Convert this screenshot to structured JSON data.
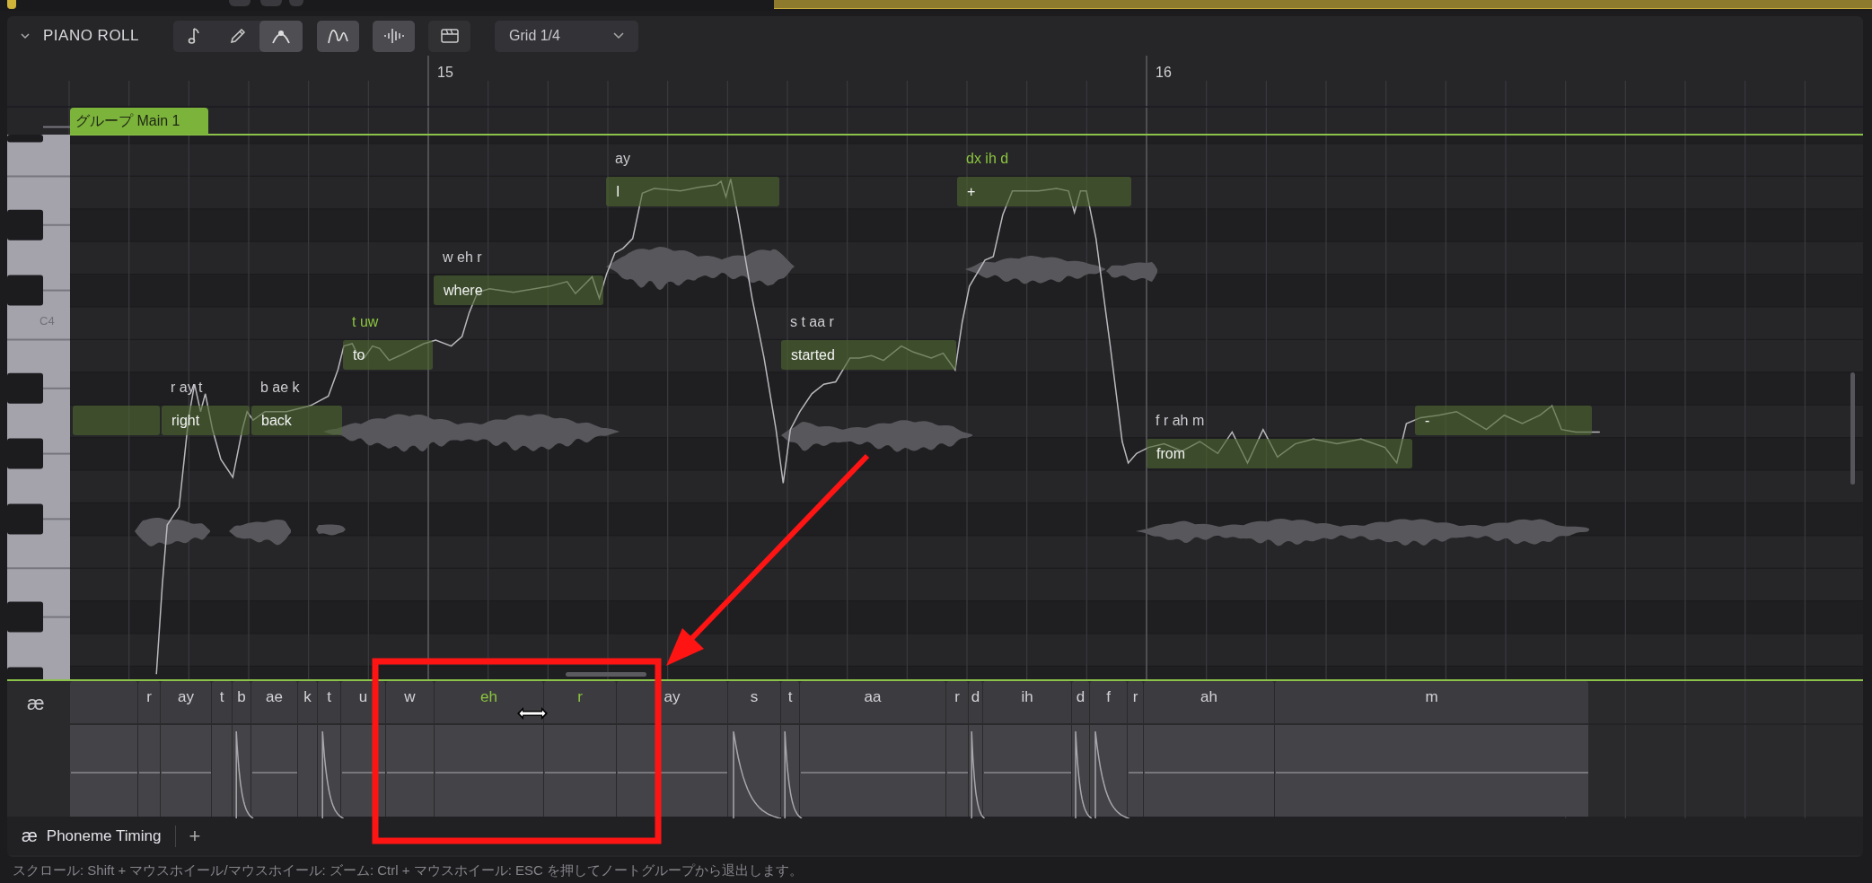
{
  "header": {
    "title": "PIANO ROLL",
    "expanded": true
  },
  "tools": [
    {
      "kind": "note",
      "selected": false
    },
    {
      "kind": "pencil",
      "selected": false
    },
    {
      "kind": "curve",
      "selected": true
    }
  ],
  "toggles": [
    {
      "kind": "pitch",
      "on": true
    },
    {
      "kind": "waveform",
      "on": true
    },
    {
      "kind": "clapper",
      "on": false
    }
  ],
  "grid_dropdown": {
    "value": "Grid 1/4"
  },
  "ruler": {
    "bars": [
      "15",
      "16"
    ]
  },
  "group": {
    "label": "グループ Main 1"
  },
  "keyboard": {
    "label": "C4"
  },
  "notes": [
    {
      "kind": "blank"
    },
    {
      "kind": "word",
      "lyric": "right",
      "phonemes": "r ay t",
      "edited": false
    },
    {
      "kind": "word",
      "lyric": "back",
      "phonemes": "b ae k",
      "edited": false
    },
    {
      "kind": "word",
      "lyric": "to",
      "phonemes": "t uw",
      "edited": true
    },
    {
      "kind": "word",
      "lyric": "where",
      "phonemes": "w eh r",
      "edited": false
    },
    {
      "kind": "word",
      "lyric": "I",
      "phonemes": "ay",
      "edited": false
    },
    {
      "kind": "word",
      "lyric": "started",
      "phonemes": "s t aa r",
      "edited": false
    },
    {
      "kind": "word",
      "lyric": "+",
      "phonemes": "dx ih d",
      "edited": true
    },
    {
      "kind": "word",
      "lyric": "from",
      "phonemes": "f r ah m",
      "edited": false
    },
    {
      "kind": "word",
      "lyric": "-"
    }
  ],
  "phoneme_lane": {
    "icon": "æ",
    "segments": [
      {
        "kind": "steady"
      },
      {
        "label": "r",
        "kind": "steady",
        "highlighted": false
      },
      {
        "label": "ay",
        "kind": "steady",
        "highlighted": false
      },
      {
        "label": "t",
        "kind": "silent",
        "highlighted": false
      },
      {
        "label": "b",
        "kind": "burst",
        "highlighted": false
      },
      {
        "label": "ae",
        "kind": "steady",
        "highlighted": false
      },
      {
        "label": "k",
        "kind": "silent",
        "highlighted": false
      },
      {
        "label": "t",
        "kind": "burst",
        "highlighted": false
      },
      {
        "label": "u",
        "kind": "steady",
        "highlighted": false
      },
      {
        "label": "w",
        "kind": "steady",
        "highlighted": false
      },
      {
        "label": "eh",
        "kind": "steady",
        "highlighted": true
      },
      {
        "label": "r",
        "kind": "steady",
        "highlighted": true
      },
      {
        "label": "ay",
        "kind": "steady",
        "highlighted": false
      },
      {
        "label": "s",
        "kind": "burst",
        "highlighted": false
      },
      {
        "label": "t",
        "kind": "burst",
        "highlighted": false
      },
      {
        "label": "aa",
        "kind": "steady",
        "highlighted": false
      },
      {
        "label": "r",
        "kind": "steady",
        "highlighted": false
      },
      {
        "label": "d",
        "kind": "burst",
        "highlighted": false
      },
      {
        "label": "ih",
        "kind": "steady",
        "highlighted": false
      },
      {
        "label": "d",
        "kind": "burst",
        "highlighted": false
      },
      {
        "label": "f",
        "kind": "burst",
        "highlighted": false
      },
      {
        "label": "r",
        "kind": "steady",
        "highlighted": false
      },
      {
        "label": "ah",
        "kind": "steady",
        "highlighted": false
      },
      {
        "label": "m",
        "kind": "steady",
        "highlighted": false
      }
    ]
  },
  "bottom_tabs": [
    {
      "icon": "æ",
      "label": "Phoneme Timing",
      "selected": true
    }
  ],
  "add_tab": "+",
  "status_bar": "スクロール: Shift + マウスホイール/マウスホイール: ズーム: Ctrl + マウスホイール: ESC を押してノートグループから退出します。"
}
